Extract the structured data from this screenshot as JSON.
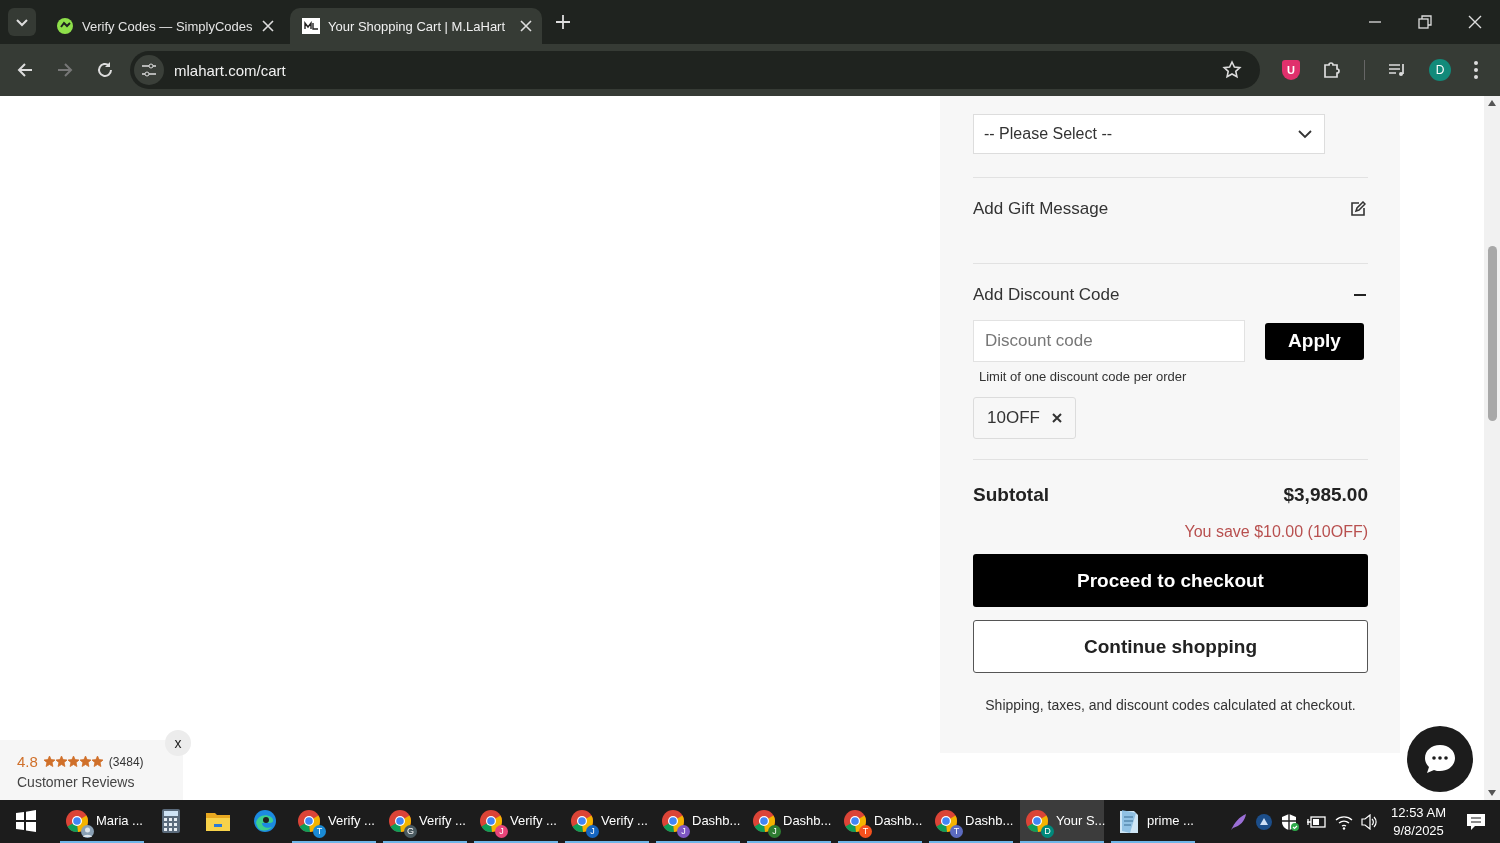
{
  "browser": {
    "tabs": [
      {
        "title": "Verify Codes — SimplyCodes",
        "selected": false,
        "kind": "simplycodes"
      },
      {
        "title": "Your Shopping Cart | M.LaHart",
        "selected": true,
        "kind": "mlahart"
      }
    ],
    "address": "mlahart.com/cart",
    "extension_label": "U",
    "profile_initial": "D"
  },
  "cart": {
    "select_placeholder": "-- Please Select --",
    "gift_label": "Add Gift Message",
    "discount": {
      "label": "Add Discount Code",
      "expanded": true,
      "placeholder": "Discount code",
      "apply": "Apply",
      "hint": "Limit of one discount code per order",
      "applied_code": "10OFF"
    },
    "subtotal_label": "Subtotal",
    "subtotal": "$3,985.00",
    "savings": "You save $10.00 (10OFF)",
    "checkout": "Proceed to checkout",
    "continue": "Continue shopping",
    "note": "Shipping, taxes, and discount codes calculated at checkout."
  },
  "reviews": {
    "rating": "4.8",
    "stars": 5,
    "count": "(3484)",
    "label": "Customer Reviews",
    "close": "x"
  },
  "taskbar": {
    "items": [
      {
        "kind": "start",
        "selected": false,
        "open": false
      },
      {
        "kind": "browser-person",
        "label": "Maria ...",
        "selected": false,
        "open": true
      },
      {
        "kind": "calculator",
        "selected": false,
        "open": false
      },
      {
        "kind": "files",
        "selected": false,
        "open": false
      },
      {
        "kind": "edge",
        "selected": false,
        "open": false
      },
      {
        "kind": "browser",
        "label": "Verify ...",
        "badge": "T",
        "color": "#1a8ad4",
        "selected": false,
        "open": true
      },
      {
        "kind": "browser",
        "label": "Verify ...",
        "badge": "G",
        "color": "#4a5a60",
        "selected": false,
        "open": true
      },
      {
        "kind": "browser",
        "label": "Verify ...",
        "badge": "J",
        "color": "#e8457a",
        "selected": false,
        "open": true
      },
      {
        "kind": "browser",
        "label": "Verify ...",
        "badge": "J",
        "color": "#1565c0",
        "selected": false,
        "open": true
      },
      {
        "kind": "browser",
        "label": "Dashb...",
        "badge": "J",
        "color": "#7e57c2",
        "selected": false,
        "open": true
      },
      {
        "kind": "browser",
        "label": "Dashb...",
        "badge": "J",
        "color": "#2e7d32",
        "selected": false,
        "open": true
      },
      {
        "kind": "browser",
        "label": "Dashb...",
        "badge": "T",
        "color": "#f4511e",
        "selected": false,
        "open": true
      },
      {
        "kind": "browser",
        "label": "Dashb...",
        "badge": "T",
        "color": "#5c6bc0",
        "selected": false,
        "open": true
      },
      {
        "kind": "browser",
        "label": "Your S...",
        "badge": "D",
        "color": "#00897b",
        "selected": true,
        "open": true
      },
      {
        "kind": "notepad",
        "label": "prime ...",
        "selected": false,
        "open": true
      }
    ],
    "time": "12:53 AM",
    "date": "9/8/2025"
  }
}
